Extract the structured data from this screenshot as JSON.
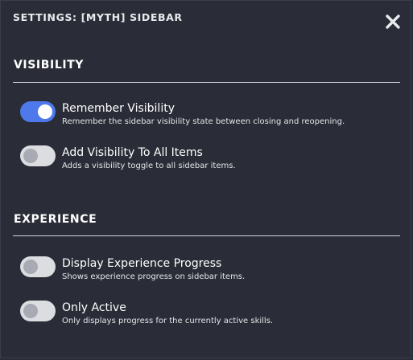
{
  "window": {
    "title": "SETTINGS: [MYTH] SIDEBAR",
    "close_icon": "close-icon"
  },
  "colors": {
    "background": "#2a2d37",
    "toggle_on": "#4d79ea",
    "toggle_off": "#dcdde1"
  },
  "sections": [
    {
      "title": "VISIBILITY",
      "settings": [
        {
          "label": "Remember Visibility",
          "description": "Remember the sidebar visibility state between closing and reopening.",
          "enabled": true
        },
        {
          "label": "Add Visibility To All Items",
          "description": "Adds a visibility toggle to all sidebar items.",
          "enabled": false
        }
      ]
    },
    {
      "title": "EXPERIENCE",
      "settings": [
        {
          "label": "Display Experience Progress",
          "description": "Shows experience progress on sidebar items.",
          "enabled": false
        },
        {
          "label": "Only Active",
          "description": "Only displays progress for the currently active skills.",
          "enabled": false
        }
      ]
    }
  ]
}
